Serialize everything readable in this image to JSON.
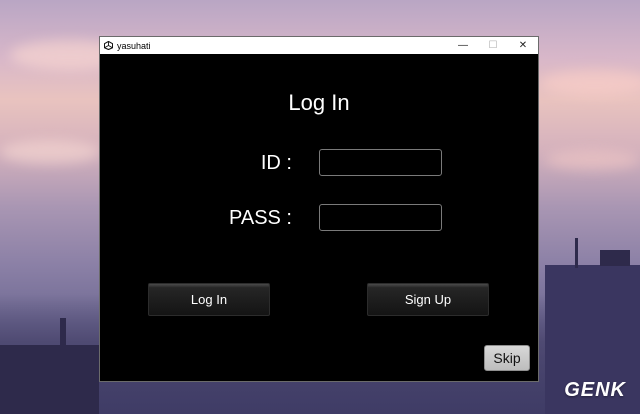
{
  "window": {
    "title": "yasuhati",
    "controls": {
      "minimize": "—",
      "maximize": "☐",
      "close": "✕"
    }
  },
  "form": {
    "heading": "Log In",
    "id_label": "ID :",
    "pass_label": "PASS :",
    "id_value": "",
    "pass_value": ""
  },
  "buttons": {
    "login": "Log In",
    "signup": "Sign Up",
    "skip": "Skip"
  },
  "watermark": "GENK",
  "colors": {
    "window_bg": "#000000",
    "text": "#ffffff",
    "skip_bg": "#c9c9c9"
  }
}
